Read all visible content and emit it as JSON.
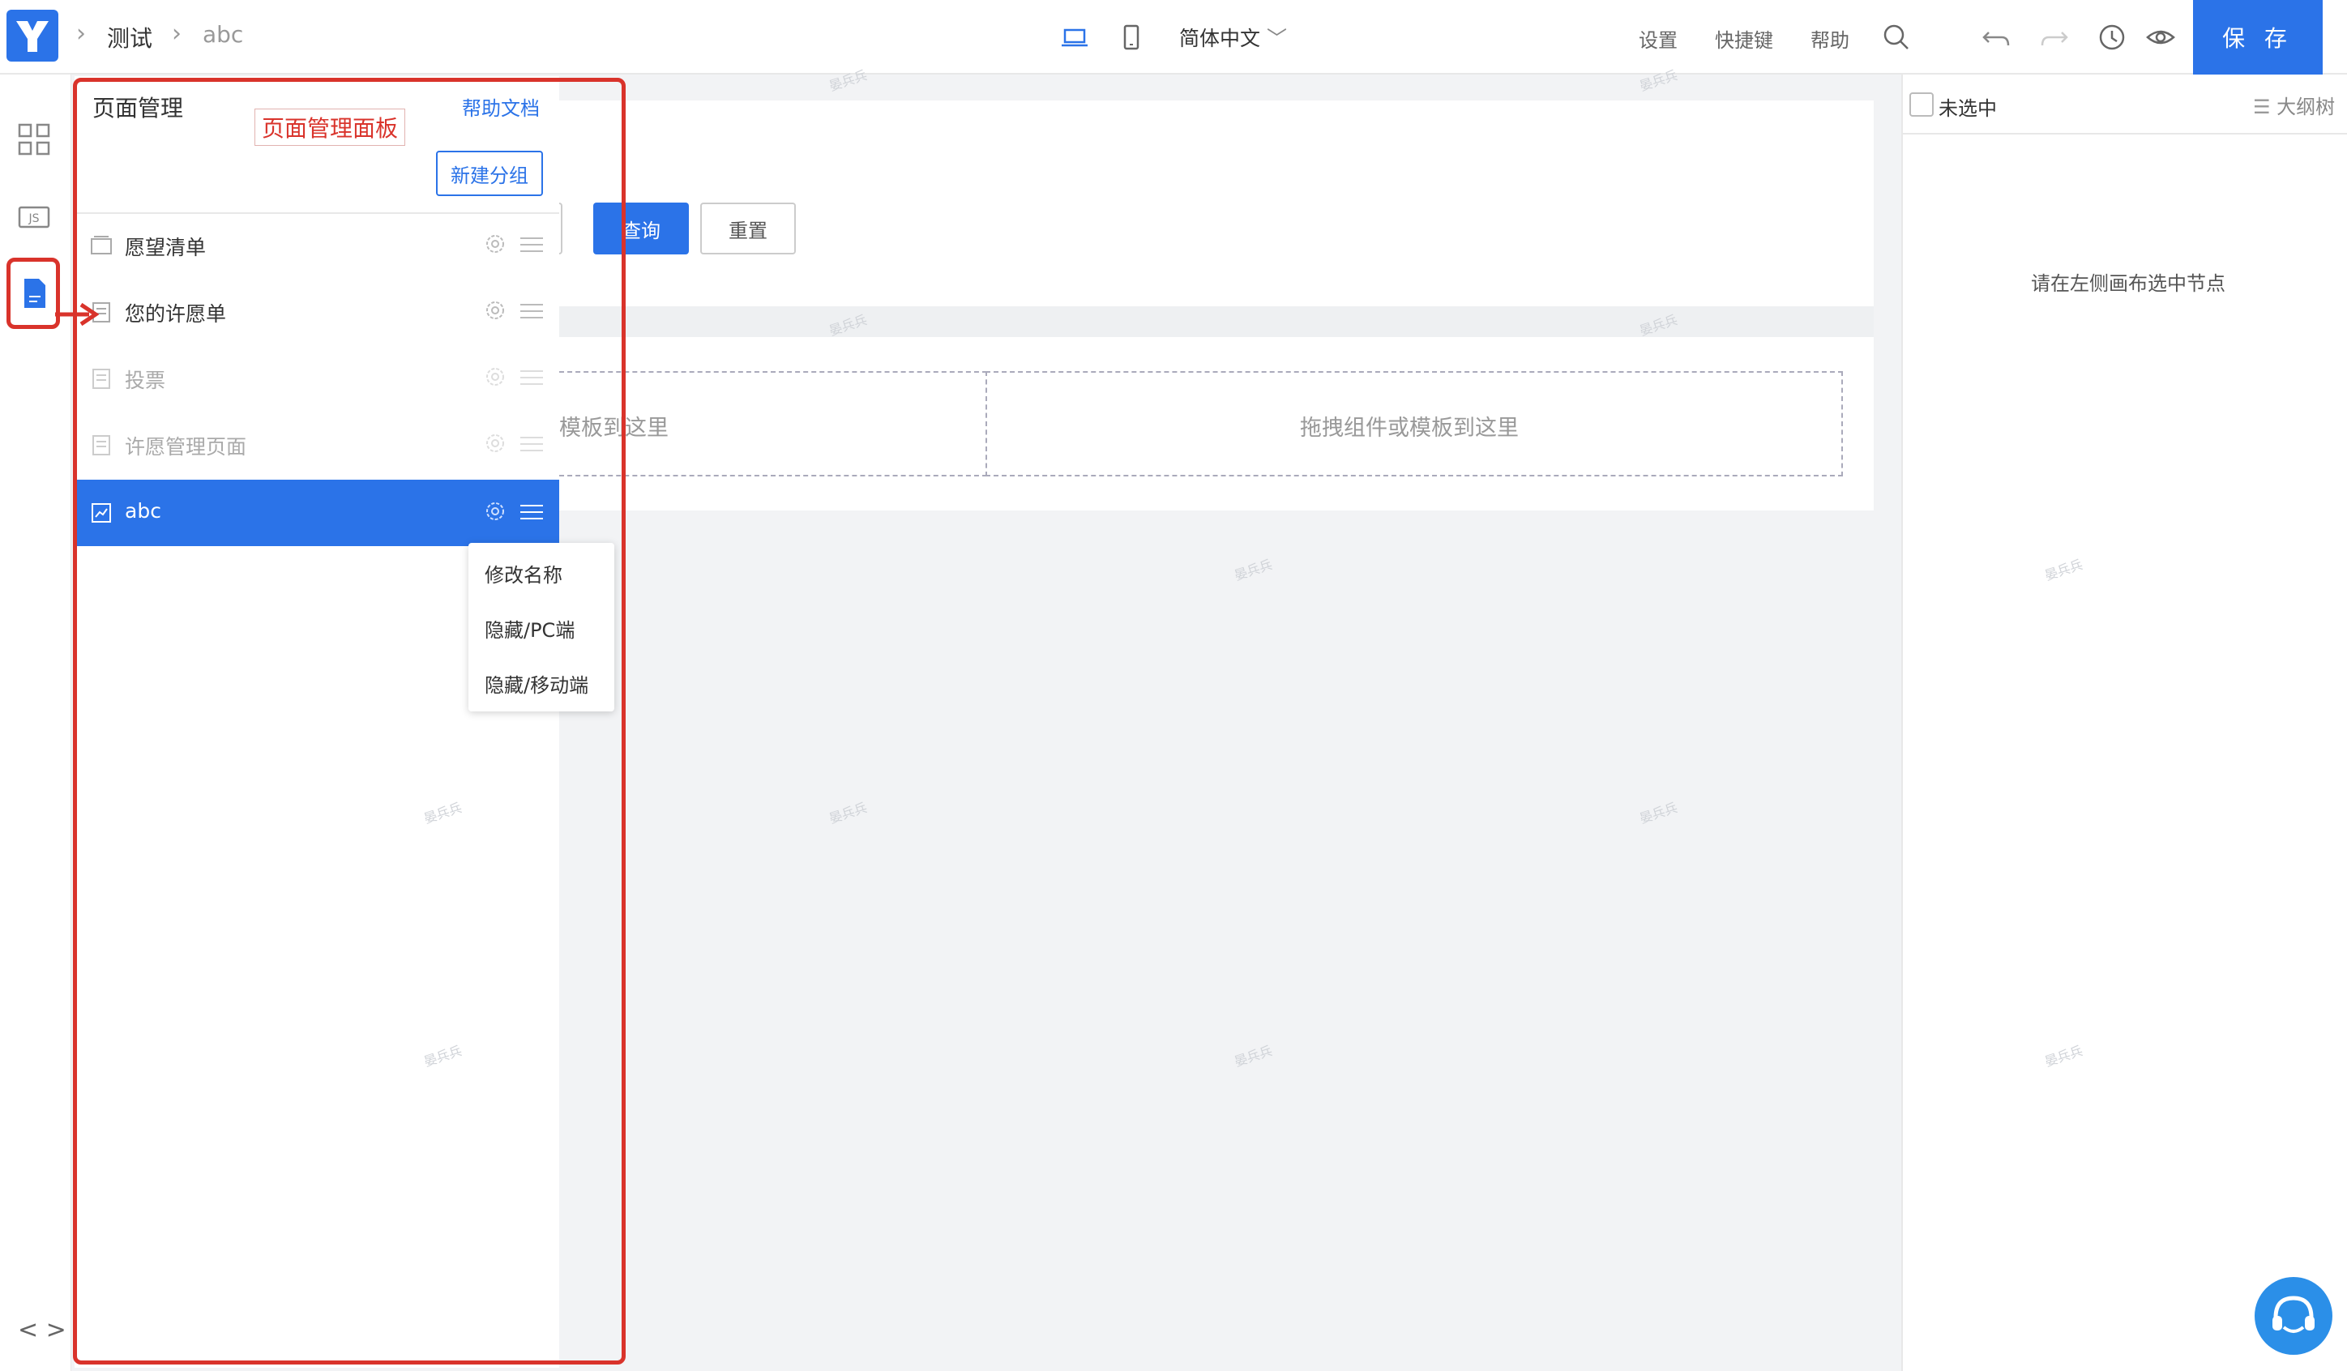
{
  "breadcrumb": {
    "app": "测试",
    "page": "abc"
  },
  "toolbar": {
    "language": "简体中文",
    "settings": "设置",
    "shortcuts": "快捷键",
    "help": "帮助",
    "save": "保 存"
  },
  "panel": {
    "title": "页面管理",
    "help_link": "帮助文档",
    "new_group": "新建分组",
    "annotation": "页面管理面板",
    "pages": [
      {
        "label": "愿望清单"
      },
      {
        "label": "您的许愿单"
      },
      {
        "label": "投票"
      },
      {
        "label": "许愿管理页面"
      },
      {
        "label": "abc"
      }
    ]
  },
  "context_menu": {
    "rename": "修改名称",
    "hide_pc": "隐藏/PC端",
    "hide_mobile": "隐藏/移动端"
  },
  "canvas": {
    "query": "查询",
    "reset": "重置",
    "drop_left": "模板到这里",
    "drop_right": "拖拽组件或模板到这里"
  },
  "right_panel": {
    "unselected": "未选中",
    "outline": "大纲树",
    "empty": "请在左侧画布选中节点"
  },
  "watermark": "晏兵兵",
  "colors": {
    "accent": "#2b73e8",
    "annotation_red": "#d9332b"
  }
}
